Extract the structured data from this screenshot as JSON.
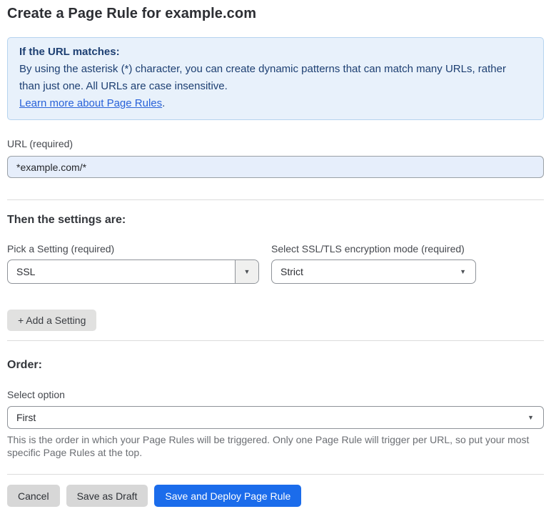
{
  "page": {
    "title": "Create a Page Rule for example.com"
  },
  "info_box": {
    "heading": "If the URL matches:",
    "body": "By using the asterisk (*) character, you can create dynamic patterns that can match many URLs, rather than just one. All URLs are case insensitive.",
    "link": "Learn more about Page Rules",
    "link_suffix": "."
  },
  "url_field": {
    "label": "URL (required)",
    "value": "*example.com/*"
  },
  "settings": {
    "heading": "Then the settings are:",
    "setting_label": "Pick a Setting (required)",
    "setting_value": "SSL",
    "mode_label": "Select SSL/TLS encryption mode (required)",
    "mode_value": "Strict",
    "add_button": "+ Add a Setting"
  },
  "order": {
    "heading": "Order:",
    "label": "Select option",
    "value": "First",
    "help": "This is the order in which your Page Rules will be triggered. Only one Page Rule will trigger per URL, so put your most specific Page Rules at the top."
  },
  "footer": {
    "cancel": "Cancel",
    "save_draft": "Save as Draft",
    "save_deploy": "Save and Deploy Page Rule"
  },
  "icons": {
    "dropdown_arrow": "▼"
  },
  "colors": {
    "accent_blue": "#1b6ceb",
    "info_bg": "#e8f1fb",
    "info_border": "#b5d3ef",
    "info_text": "#1d3f72",
    "link_blue": "#2962d9",
    "input_bg": "#e6eefb",
    "button_gray": "#d7d7d7"
  }
}
